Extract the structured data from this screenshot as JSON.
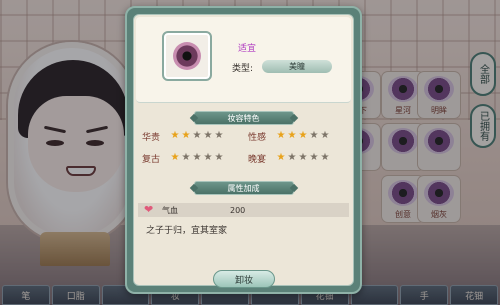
{
  "background": {
    "bottom_tabs": [
      "笔",
      "口脂",
      "",
      "妆",
      "",
      "",
      "花钿",
      "",
      "手",
      "花钿"
    ],
    "side_tabs": [
      "全部",
      "已拥有"
    ],
    "eye_labels": [
      "梦下",
      "星河",
      "明眸",
      "",
      "",
      "",
      "创意",
      "烟灰"
    ]
  },
  "item": {
    "name": "适宜",
    "type_label": "类型:",
    "type_value": "美瞳"
  },
  "traits": {
    "title": "妆容特色",
    "stats": [
      {
        "label": "华贵",
        "stars": 2
      },
      {
        "label": "性感",
        "stars": 3
      },
      {
        "label": "复古",
        "stars": 1
      },
      {
        "label": "晚宴",
        "stars": 1
      }
    ],
    "max_stars": 5
  },
  "attributes": {
    "title": "属性加成",
    "rows": [
      {
        "name": "气血",
        "value": "200",
        "icon": "heart-icon"
      }
    ]
  },
  "description": "之子于归，宜其室家",
  "actions": {
    "remove_label": "卸妆"
  },
  "colors": {
    "panel_frame": "#5b8178",
    "panel_bg": "#ece6d8",
    "star_on": "#e8a21a",
    "star_off": "#7d7468",
    "item_name": "#b03ac0",
    "stat_label": "#7a3b2f"
  }
}
